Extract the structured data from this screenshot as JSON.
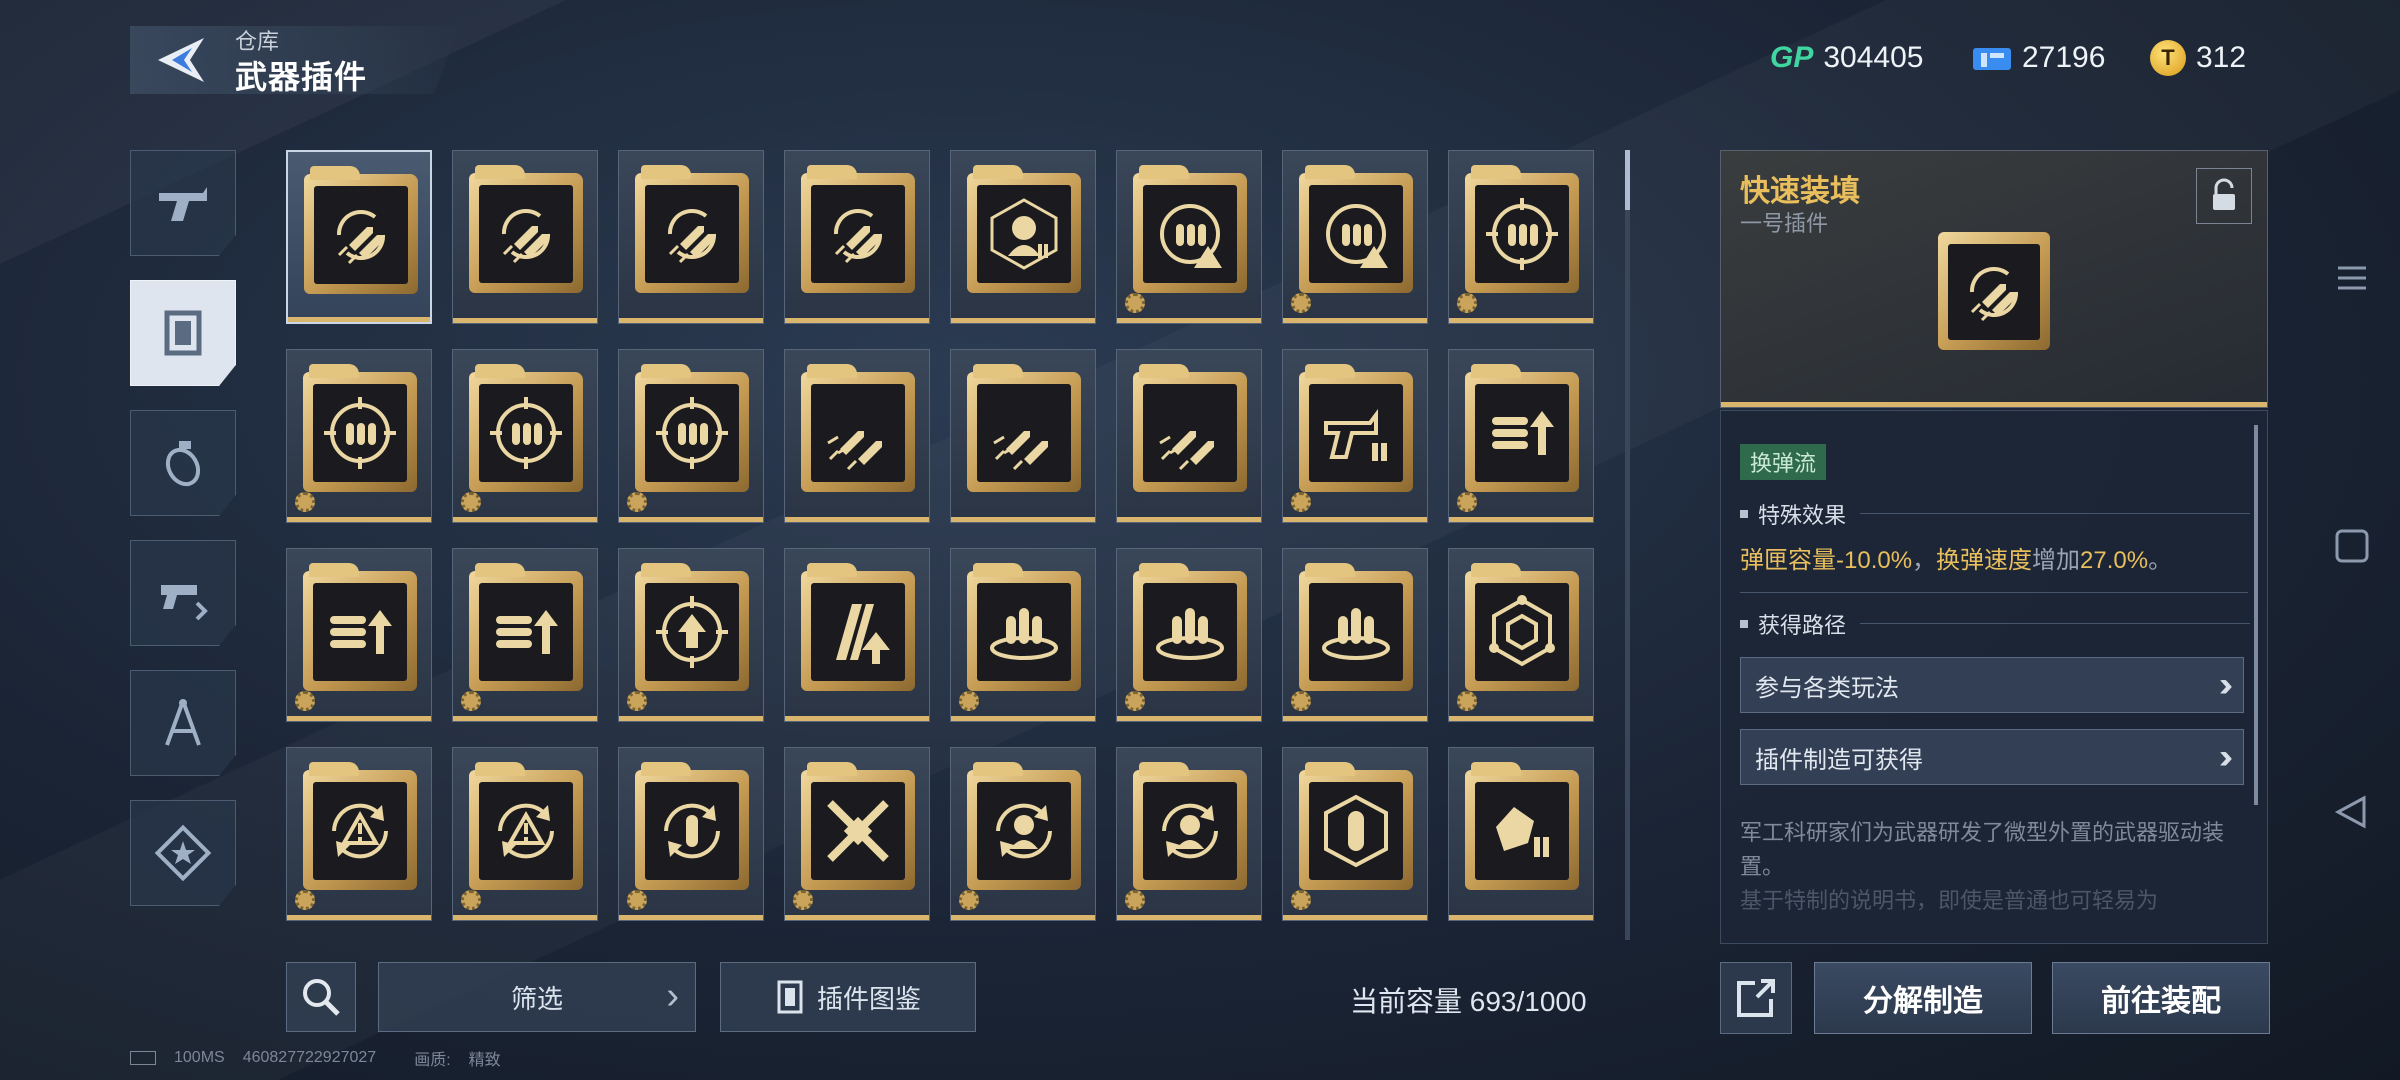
{
  "header": {
    "crumb": "仓库",
    "title": "武器插件"
  },
  "currency": {
    "gp_label": "GP",
    "gp": "304405",
    "tickets": "27196",
    "coins": "312",
    "coin_glyph": "T"
  },
  "tabs": [
    {
      "name": "pistol-icon"
    },
    {
      "name": "plugin-icon",
      "active": true
    },
    {
      "name": "grenade-icon"
    },
    {
      "name": "gun-swap-icon"
    },
    {
      "name": "compass-icon"
    },
    {
      "name": "star-badge-icon"
    }
  ],
  "plugins": [
    {
      "icon": "rocket-reload"
    },
    {
      "icon": "rocket-reload"
    },
    {
      "icon": "rocket-reload"
    },
    {
      "icon": "rocket-reload"
    },
    {
      "icon": "target-bust"
    },
    {
      "icon": "ammo-warning",
      "gear": true
    },
    {
      "icon": "ammo-warning",
      "gear": true
    },
    {
      "icon": "ammo-target",
      "gear": true
    },
    {
      "icon": "ammo-target",
      "gear": true
    },
    {
      "icon": "ammo-target",
      "gear": true
    },
    {
      "icon": "ammo-target",
      "gear": true
    },
    {
      "icon": "rocket-ammo"
    },
    {
      "icon": "rocket-ammo"
    },
    {
      "icon": "rocket-ammo"
    },
    {
      "icon": "pistol-ammo",
      "gear": true
    },
    {
      "icon": "ammo-up",
      "gear": true
    },
    {
      "icon": "ammo-up",
      "gear": true
    },
    {
      "icon": "ammo-up",
      "gear": true
    },
    {
      "icon": "target-up",
      "gear": true
    },
    {
      "icon": "mag-up"
    },
    {
      "icon": "ammo-ring",
      "gear": true
    },
    {
      "icon": "ammo-ring",
      "gear": true
    },
    {
      "icon": "ammo-ring",
      "gear": true
    },
    {
      "icon": "hex-network",
      "gear": true
    },
    {
      "icon": "cycle-warning",
      "gear": true
    },
    {
      "icon": "cycle-warning",
      "gear": true
    },
    {
      "icon": "cycle-bullet",
      "gear": true
    },
    {
      "icon": "cross-swords",
      "gear": true
    },
    {
      "icon": "cycle-bust",
      "gear": true
    },
    {
      "icon": "cycle-bust",
      "gear": true
    },
    {
      "icon": "hex-bullet",
      "gear": true
    },
    {
      "icon": "hand-ammo"
    }
  ],
  "detail": {
    "name": "快速装填",
    "slot": "一号插件",
    "tag": "换弹流",
    "effect_title": "特殊效果",
    "effect": {
      "a_key": "弹匣容量",
      "a_val": "-10.0%",
      "sep": "，",
      "b_key": "换弹速度",
      "b_mid": "增加",
      "b_val": "27.0%",
      "end": "。"
    },
    "source_title": "获得路径",
    "sources": [
      "参与各类玩法",
      "插件制造可获得"
    ],
    "desc_1": "军工科研家们为武器研发了微型外置的武器驱动装置。",
    "desc_2": "基于特制的说明书，即使是普通也可轻易为"
  },
  "bottom": {
    "filter": "筛选",
    "atlas": "插件图鉴",
    "capacity_label": "当前容量 ",
    "capacity": "693/1000",
    "disassemble": "分解制造",
    "equip": "前往装配"
  },
  "footer": {
    "ping": "100MS",
    "uid": "460827722927027",
    "quality_label": "画质:",
    "quality": "精致"
  },
  "colors": {
    "gold": "#e9be5c",
    "accent_green": "#3fd6a0",
    "tag_green": "#2f6a4c"
  }
}
